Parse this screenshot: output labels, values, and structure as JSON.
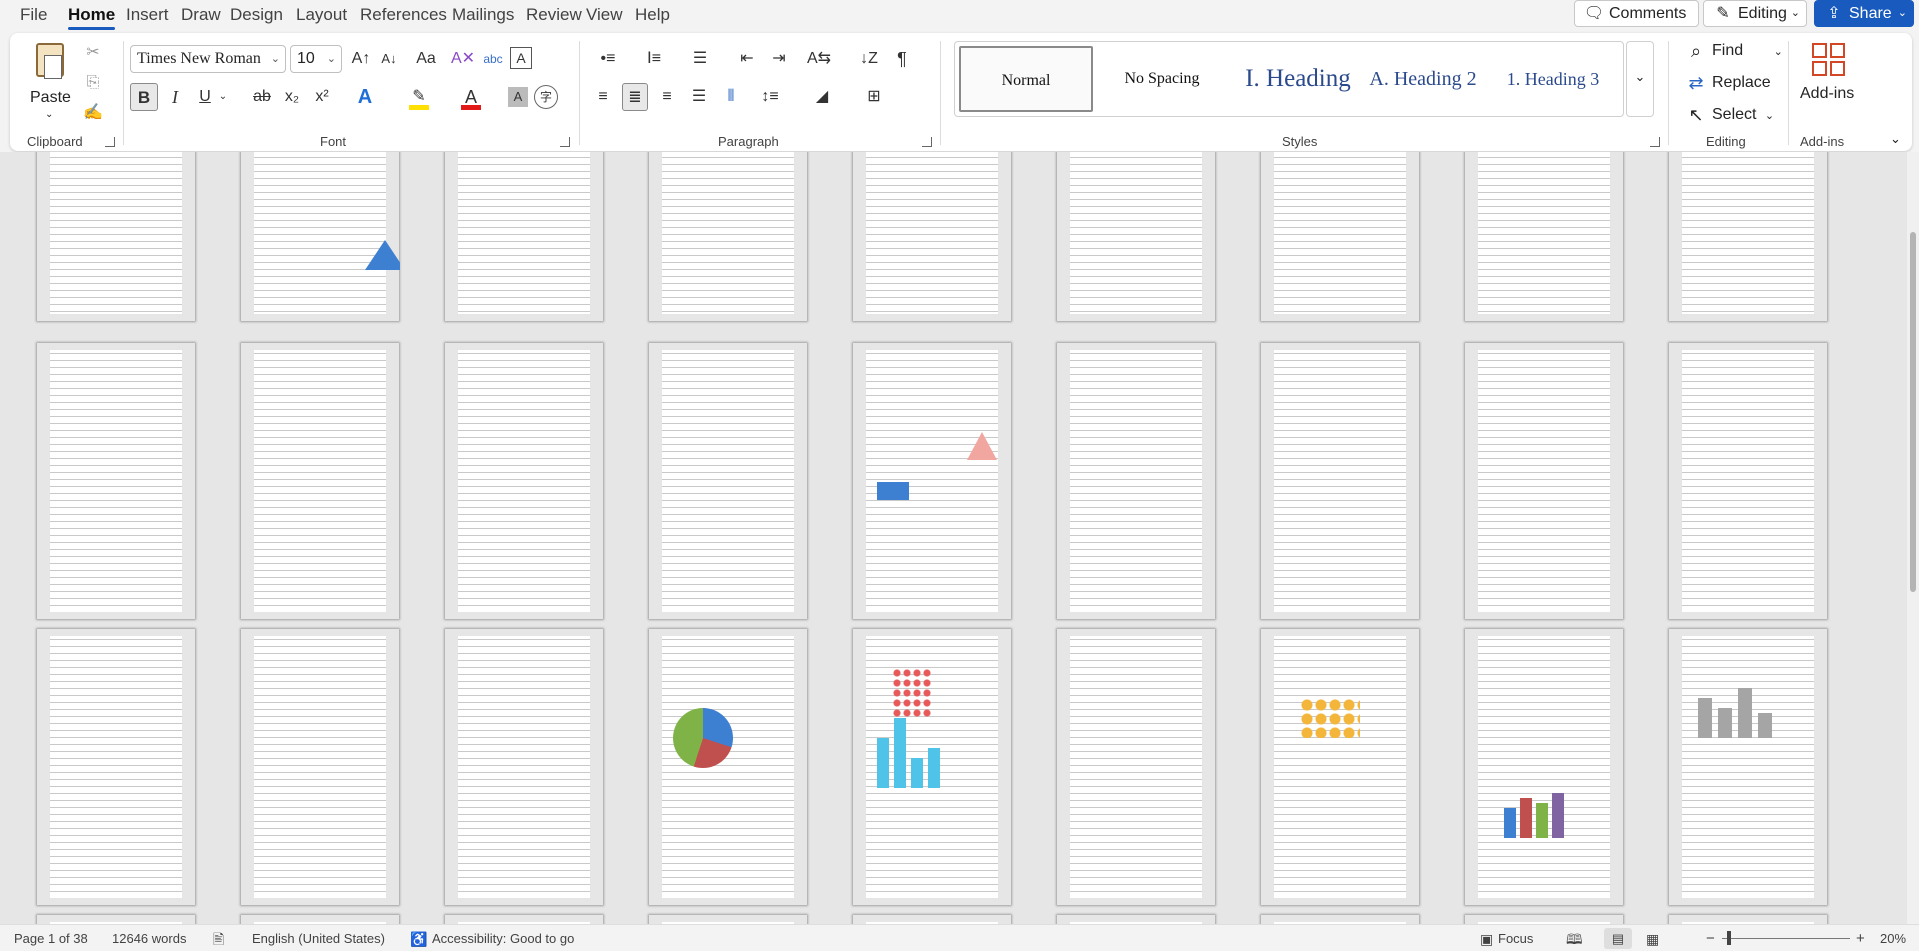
{
  "menu": {
    "tabs": [
      "File",
      "Home",
      "Insert",
      "Draw",
      "Design",
      "Layout",
      "References",
      "Mailings",
      "Review",
      "View",
      "Help"
    ],
    "active": "Home",
    "comments_label": "Comments",
    "editing_label": "Editing",
    "share_label": "Share"
  },
  "clipboard": {
    "paste_label": "Paste",
    "group_label": "Clipboard"
  },
  "font": {
    "name": "Times New Roman",
    "size": "10",
    "group_label": "Font",
    "buttons": {
      "bold": "B",
      "italic": "I",
      "underline": "U",
      "strike": "ab",
      "subscript": "x₂",
      "superscript": "x²",
      "change_case": "Aa"
    }
  },
  "paragraph": {
    "group_label": "Paragraph"
  },
  "styles": {
    "group_label": "Styles",
    "items": [
      {
        "label": "Normal"
      },
      {
        "label": "No Spacing"
      },
      {
        "label": "I. Heading"
      },
      {
        "label": "A. Heading 2"
      },
      {
        "label": "1. Heading 3"
      }
    ]
  },
  "editing": {
    "group_label": "Editing",
    "find": "Find",
    "replace": "Replace",
    "select": "Select"
  },
  "addins": {
    "label": "Add-ins",
    "group_label": "Add-ins"
  },
  "status": {
    "page": "Page 1 of 38",
    "words": "12646 words",
    "language": "English (United States)",
    "accessibility": "Accessibility: Good to go",
    "focus": "Focus",
    "zoom": "20%"
  },
  "colors": {
    "accent": "#185abd",
    "highlight": "#ffe000",
    "font_color": "#e21a1a"
  }
}
